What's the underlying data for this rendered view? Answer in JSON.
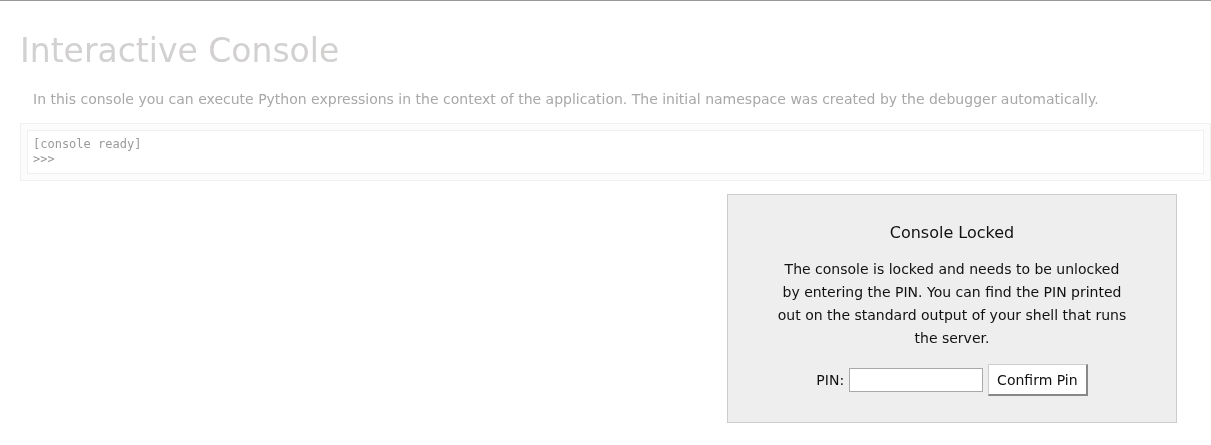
{
  "page": {
    "title": "Interactive Console",
    "description": "In this console you can execute Python expressions in the context of the application. The initial namespace was created by the debugger automatically."
  },
  "console": {
    "lines": [
      "[console ready]",
      ">>>"
    ]
  },
  "dialog": {
    "title": "Console Locked",
    "message": "The console is locked and needs to be unlocked by entering the PIN. You can find the PIN printed out on the standard output of your shell that runs the server.",
    "pin_label": "PIN:",
    "button": "Confirm Pin"
  }
}
